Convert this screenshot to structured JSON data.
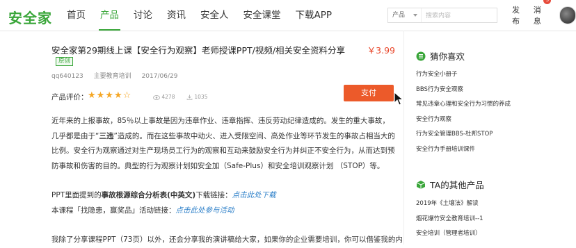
{
  "header": {
    "logo": "安全家",
    "nav": [
      "首页",
      "产品",
      "讨论",
      "资讯",
      "安全人",
      "安全课堂",
      "下载APP"
    ],
    "active_nav": "产品",
    "search": {
      "category": "产品",
      "placeholder": "搜索内容"
    },
    "publish_label": "发布",
    "messages_label": "消息",
    "messages_count": "5"
  },
  "product": {
    "title": "安全家第29期线上课【安全行为观察】老师授课PPT/视频/相关安全资料分享",
    "price": "￥3.99",
    "tag": "原创",
    "author": "qq640123",
    "category": "主要教育培训",
    "date": "2017/06/29",
    "rating_label": "产品评价：",
    "stars": "★★★★☆",
    "rating": 4.5,
    "views": "4278",
    "downloads": "1035",
    "pay_label": "支付"
  },
  "content": {
    "p1_a": "近年来的上报事故，85％以上事故是因为违章作业、违章指挥、违反劳动纪律造成的。发生的重大事故，几乎都是由于“",
    "p1_bold": "三违",
    "p1_b": "”造成的。而在这些事故中动火、进入受限空间、高处作业等环节发生的事故占相当大的比例。安全行为观察通过对生产现场员工行为的观察和互动来鼓励安全行为并纠正不安全行为，从而达到预防事故和伤害的目的。典型的行为观察计划如安全加（Safe-Plus）和安全培训观察计划 （STOP）等。",
    "p2_pre": "PPT里面提到的",
    "p2_bold": "事故根源综合分析表(中英文)",
    "p2_mid": "下载链接：",
    "p2_link": "点击此处下载",
    "p3_pre": "本课程「找隐患，赢奖品」活动链接：",
    "p3_link": "点击此处参与活动",
    "p4": "我除了分享课程PPT（73页）以外，还会分享我的演讲稿给大家，如果你的企业需要培训，你可以借鉴我的内"
  },
  "sidebar": {
    "guess_title": "猜你喜欢",
    "guess_items": [
      "行为安全小册子",
      "BBS行为安全观察",
      "常见违章心理和安全行为习惯的养成",
      "安全行为观察",
      "行为安全管理BBS-杜邦STOP",
      "安全行为手册培训课件"
    ],
    "other_title": "TA的其他产品",
    "other_items": [
      "2019年《土壤法》解读",
      "烟花爆竹安全教育培训--1",
      "安全培训（管理者培训）"
    ]
  },
  "colors": {
    "brand": "#3aa63a",
    "price": "#e8462a",
    "pay": "#ec5a2a",
    "link": "#2a7ec8"
  }
}
